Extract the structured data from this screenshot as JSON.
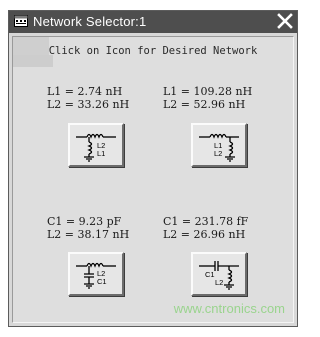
{
  "window": {
    "title": "Network Selector:1"
  },
  "instruction": "Click on Icon for Desired Network",
  "networks": [
    {
      "line1": "L1 = 2.74 nH",
      "line2": "L2 = 33.26 nH",
      "icon_top_label": "L2",
      "icon_bottom_label": "L1"
    },
    {
      "line1": "L1 = 109.28 nH",
      "line2": "L2 = 52.96 nH",
      "icon_top_label": "L1",
      "icon_bottom_label": "L2"
    },
    {
      "line1": "C1 = 9.23 pF",
      "line2": "L2 = 38.17 nH",
      "icon_top_label": "L2",
      "icon_bottom_label": "C1"
    },
    {
      "line1": "C1 = 231.78 fF",
      "line2": "L2 = 26.96 nH",
      "icon_top_label": "C1",
      "icon_bottom_label": "L2"
    }
  ],
  "watermark": "www.cntronics.com",
  "colors": {
    "titlebar": "#4e4e4e",
    "client_bg": "#dedede",
    "watermark": "#9ad48e"
  },
  "icons": {
    "app": "network-app-icon",
    "close": "close-x-icon"
  }
}
